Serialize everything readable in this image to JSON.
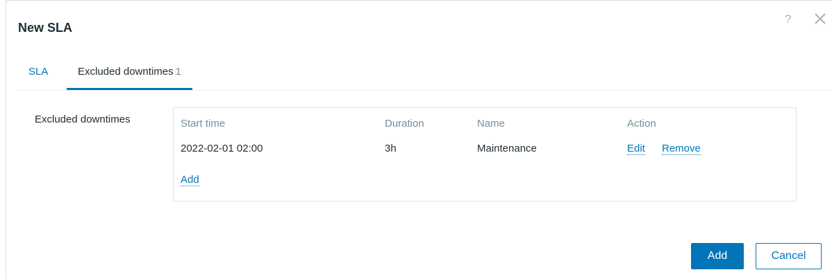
{
  "dialog": {
    "title": "New SLA",
    "help_icon": "?",
    "icons": [
      "help-icon",
      "close-icon"
    ]
  },
  "tabs": [
    {
      "label": "SLA",
      "active": false
    },
    {
      "label": "Excluded downtimes",
      "count": "1",
      "active": true
    }
  ],
  "form": {
    "field_label": "Excluded downtimes",
    "table": {
      "columns": [
        "Start time",
        "Duration",
        "Name",
        "Action"
      ],
      "rows": [
        {
          "start_time": "2022-02-01 02:00",
          "duration": "3h",
          "name": "Maintenance",
          "actions": [
            "Edit",
            "Remove"
          ]
        }
      ],
      "add_link": "Add"
    }
  },
  "footer": {
    "add_label": "Add",
    "cancel_label": "Cancel"
  },
  "colors": {
    "accent": "#0275b8",
    "muted_text": "#768d99",
    "text": "#1f2c33",
    "border": "#dfe4e7"
  }
}
